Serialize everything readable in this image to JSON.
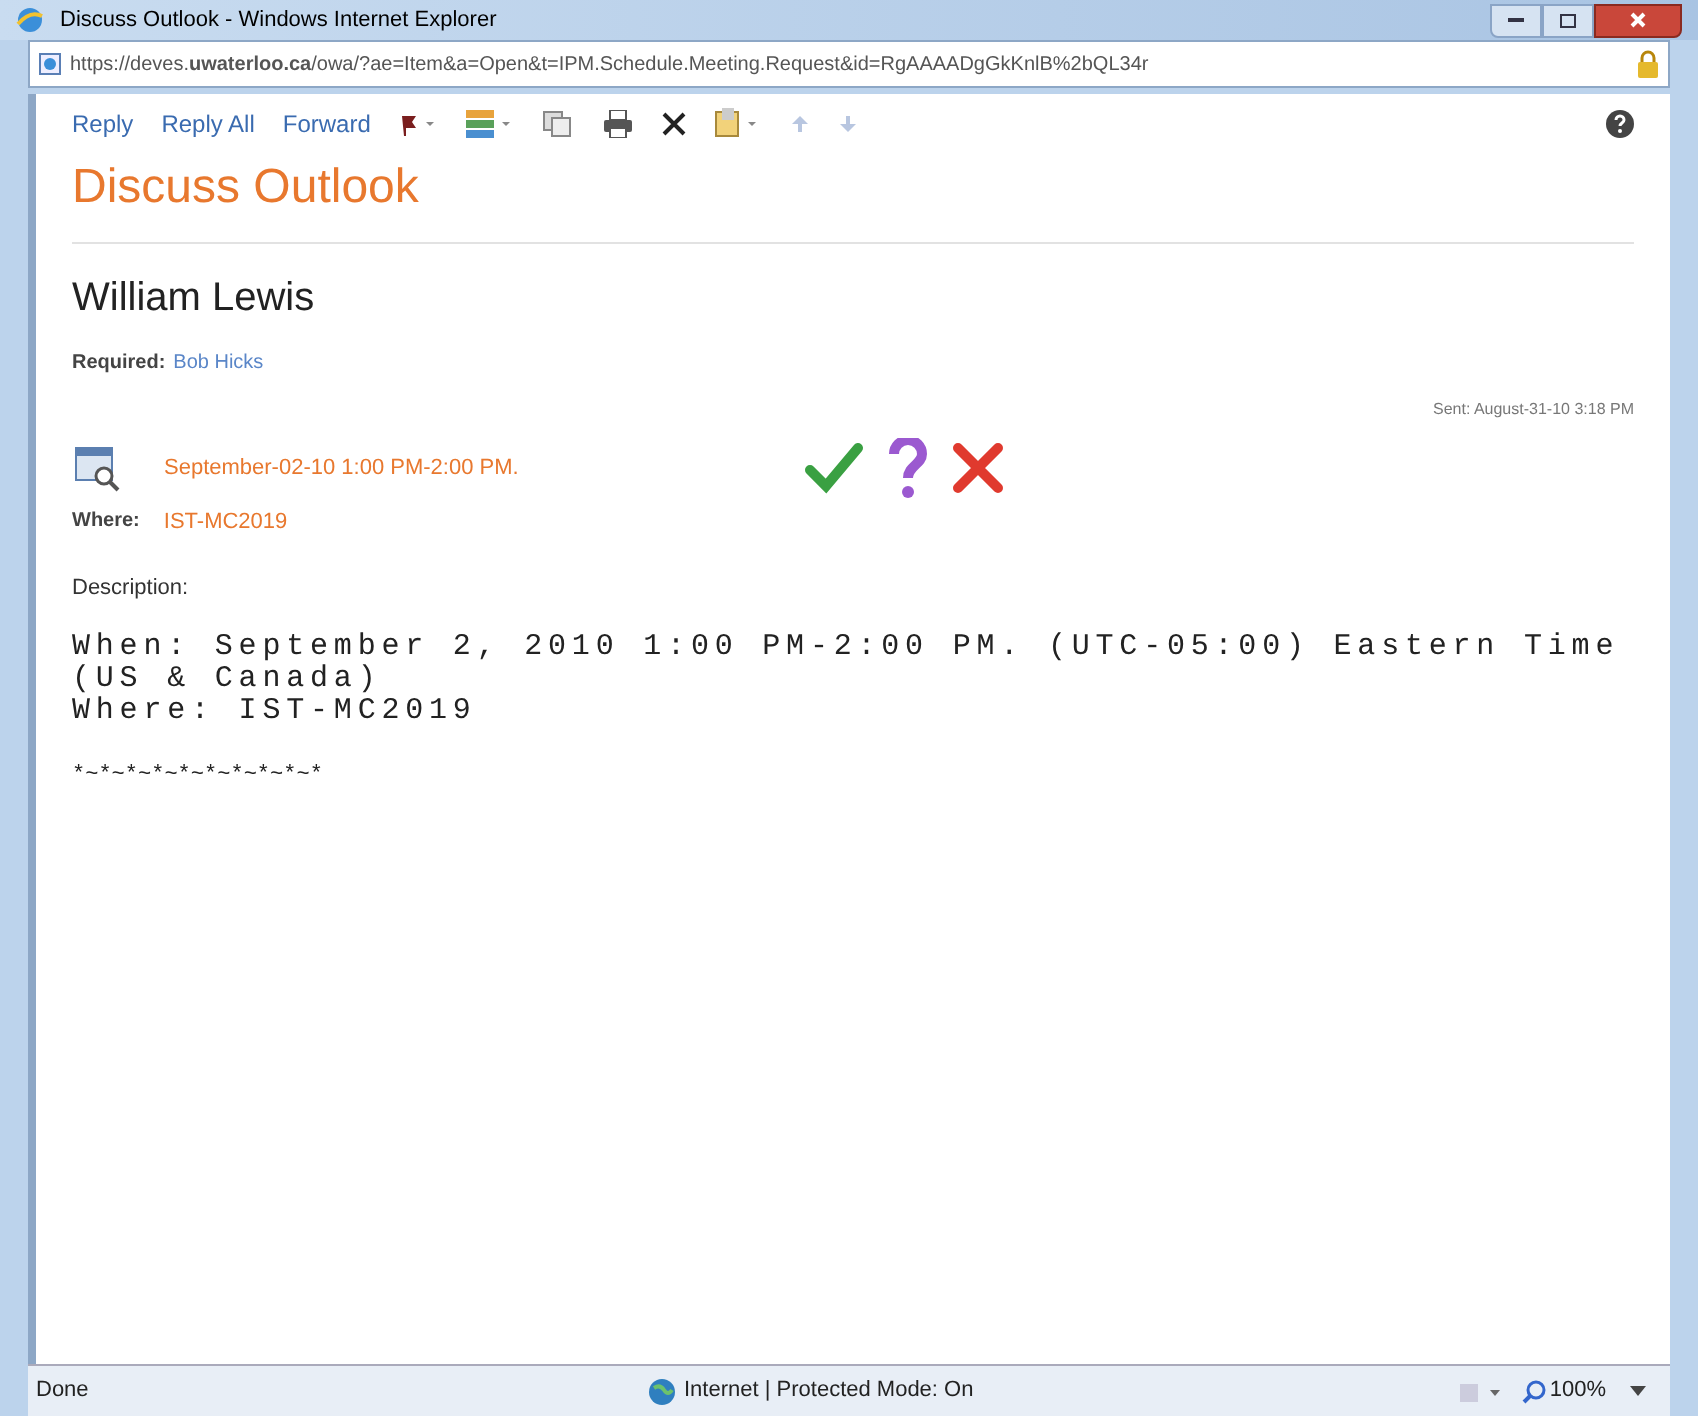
{
  "window": {
    "title": "Discuss Outlook - Windows Internet Explorer"
  },
  "address_bar": {
    "url": "https://deves.**uwaterloo.ca**/owa/?ae=Item&a=Open&t=IPM.Schedule.Meeting.Request&id=RgAAAADgGkKnlB%2bQL34r"
  },
  "toolbar": {
    "actions": [
      "Reply",
      "Reply All",
      "Forward"
    ]
  },
  "message": {
    "subject": "Discuss Outlook",
    "organizer": "William Lewis",
    "required_label": "Required:",
    "required": "Bob Hicks",
    "sent": "Sent: August-31-10 3:18 PM",
    "when": "September-02-10 1:00 PM-2:00 PM.",
    "where_label": "Where:",
    "where": "IST-MC2019",
    "description_label": "Description:",
    "body": [
      "When: September 2, 2010 1:00 PM-2:00 PM. (UTC-05:00) Eastern Time (US & Canada)",
      "Where: IST-MC2019"
    ],
    "separator": "*~*~*~*~*~*~*~*~*~*"
  },
  "status_bar": {
    "status": "Done",
    "zone": "Internet | Protected Mode: On",
    "zoom": "100%"
  }
}
